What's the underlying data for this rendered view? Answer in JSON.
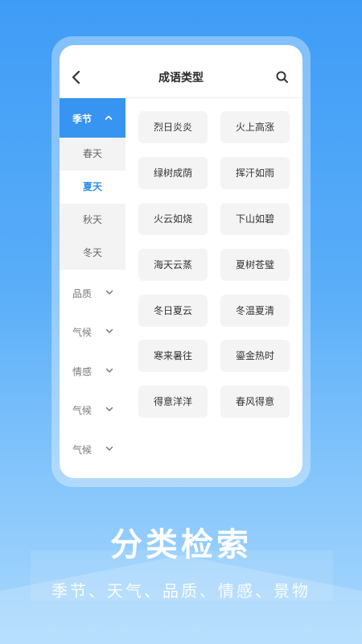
{
  "header": {
    "title": "成语类型"
  },
  "sidebar": {
    "expanded": {
      "label": "季节",
      "subitems": [
        "春天",
        "夏天",
        "秋天",
        "冬天"
      ],
      "active_index": 1
    },
    "categories": [
      "品质",
      "气候",
      "情感",
      "气候",
      "气候"
    ]
  },
  "idioms": [
    "烈日炎炎",
    "火上高涨",
    "绿树成荫",
    "挥汗如雨",
    "火云如烧",
    "下山如碧",
    "海天云蒸",
    "夏树苍璧",
    "冬日夏云",
    "冬温夏清",
    "寒来暑往",
    "鎏金热时",
    "得意洋洋",
    "春风得意"
  ],
  "promo": {
    "headline": "分类检索",
    "subline": "季节、天气、品质、情感、景物"
  },
  "colors": {
    "accent": "#3794f1",
    "active_text": "#2f8df0"
  },
  "icons": {
    "back": "chevron-left-icon",
    "search": "search-icon",
    "collapse": "chevron-up-icon",
    "expand": "chevron-down-icon"
  }
}
